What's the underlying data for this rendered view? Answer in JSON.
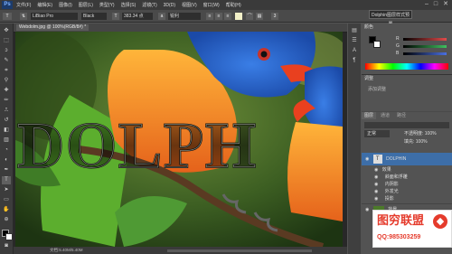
{
  "app": {
    "logo": "Ps"
  },
  "menu": [
    "文件(F)",
    "编辑(E)",
    "图像(I)",
    "图层(L)",
    "类型(Y)",
    "选择(S)",
    "滤镜(T)",
    "3D(D)",
    "视图(V)",
    "窗口(W)",
    "帮助(H)"
  ],
  "window_controls": {
    "minimize": "–",
    "maximize": "□",
    "close": "✕"
  },
  "options": {
    "tool_icon": "T",
    "font_family": "LiBiao Pro",
    "font_style": "Black",
    "font_size": "383.34 点",
    "antialias": "锐利",
    "workspace": "Dolphin图层样式预置"
  },
  "document": {
    "tab": "Webdolm.jpg @ 100%(RGB/8#) *",
    "canvas_text": "DOLPH",
    "status": "文档:5.40M/5.40M"
  },
  "color_panel": {
    "sliders": [
      {
        "label": "R",
        "value": ""
      },
      {
        "label": "G",
        "value": ""
      },
      {
        "label": "B",
        "value": ""
      }
    ],
    "colors": {
      "fg": "#000000",
      "bg": "#ffffff",
      "r_track": "#e14b4b",
      "g_track": "#3fbf5f",
      "b_track": "#4a6fe0"
    }
  },
  "layers_panel": {
    "tabs": [
      "图层",
      "通道",
      "路径"
    ],
    "blend_mode": "正常",
    "opacity": "不透明度: 100%",
    "fill": "填充: 100%",
    "layers": [
      {
        "name": "DOLPHIN",
        "type": "text",
        "selected": true
      },
      {
        "name": "效果",
        "type": "effect-group"
      },
      {
        "name": "斜面和浮雕",
        "type": "effect"
      },
      {
        "name": "内阴影",
        "type": "effect"
      },
      {
        "name": "外发光",
        "type": "effect"
      },
      {
        "name": "投影",
        "type": "effect"
      },
      {
        "name": "背景",
        "type": "background"
      }
    ]
  },
  "watermark": {
    "title": "图穷联盟",
    "qq": "QQ:985303259",
    "accent": "#e53b2c"
  }
}
